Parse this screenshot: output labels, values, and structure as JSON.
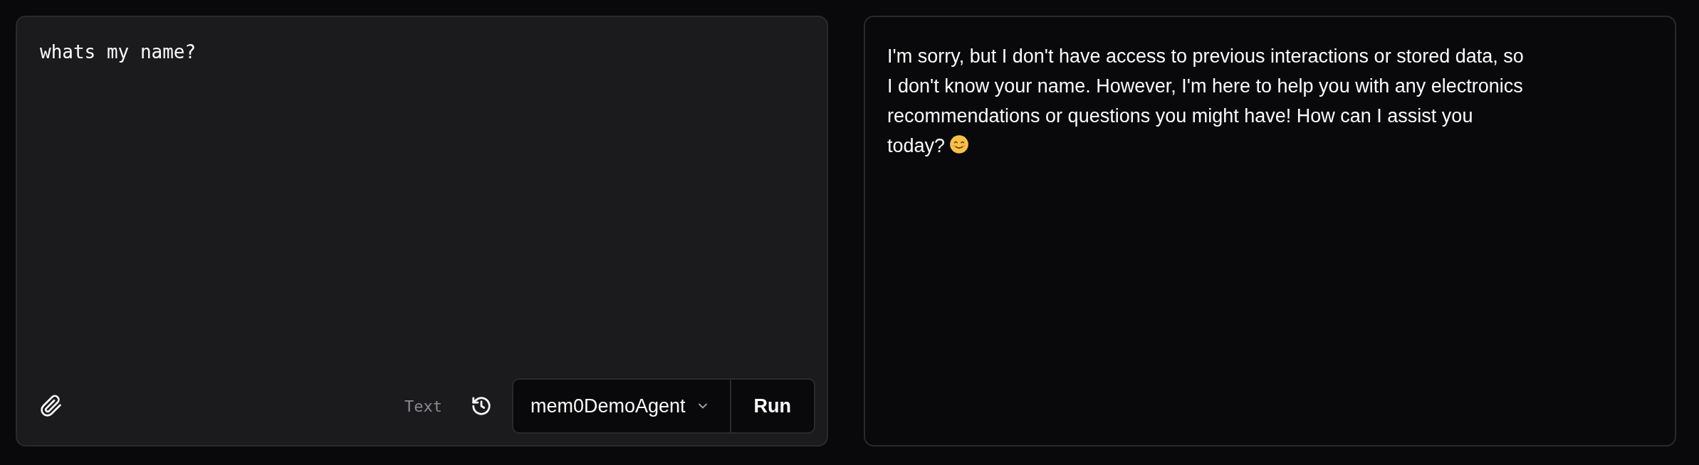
{
  "prompt": {
    "value": "whats my name?"
  },
  "toolbar": {
    "mode_label": "Text",
    "agent_select": {
      "value": "mem0DemoAgent"
    },
    "run_button": "Run"
  },
  "response": {
    "text": "I'm sorry, but I don't have access to previous interactions or stored data, so I don't know your name. However, I'm here to help you with any electronics recommendations or questions you might have! How can I assist you today?"
  }
}
